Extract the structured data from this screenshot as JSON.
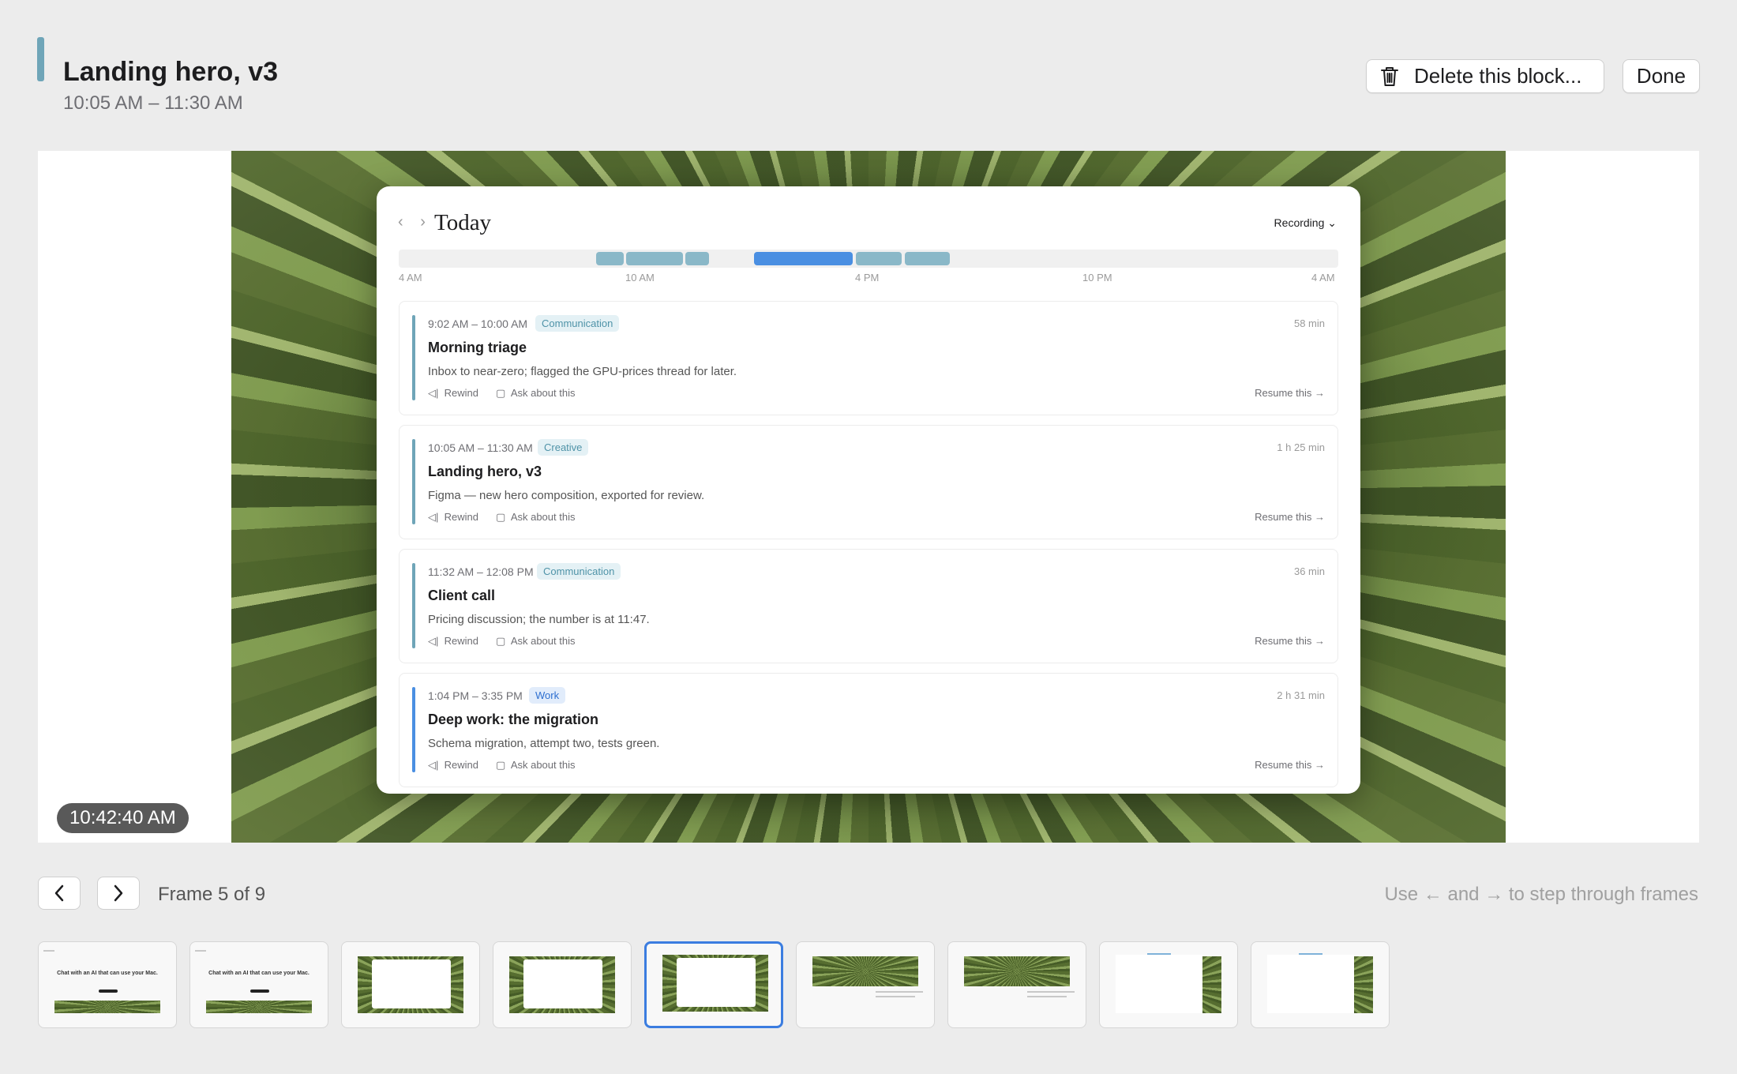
{
  "header": {
    "title": "Landing hero, v3",
    "time_range": "10:05 AM – 11:30 AM",
    "delete_label": "Delete this block...",
    "done_label": "Done"
  },
  "preview": {
    "timestamp": "10:42:40 AM",
    "app": {
      "title": "Today",
      "recording_label": "Recording",
      "timeline_ticks": [
        "4 AM",
        "10 AM",
        "4 PM",
        "10 PM",
        "4 AM"
      ],
      "cards": [
        {
          "time": "9:02 AM – 10:00 AM",
          "tag": "Communication",
          "title": "Morning triage",
          "description": "Inbox to near-zero; flagged the GPU-prices thread for later.",
          "duration": "58 min",
          "rewind": "Rewind",
          "ask": "Ask about this",
          "resume": "Resume this →"
        },
        {
          "time": "10:05 AM – 11:30 AM",
          "tag": "Creative",
          "title": "Landing hero, v3",
          "description": "Figma — new hero composition, exported for review.",
          "duration": "1 h 25 min",
          "rewind": "Rewind",
          "ask": "Ask about this",
          "resume": "Resume this →"
        },
        {
          "time": "11:32 AM – 12:08 PM",
          "tag": "Communication",
          "title": "Client call",
          "description": "Pricing discussion; the number is at 11:47.",
          "duration": "36 min",
          "rewind": "Rewind",
          "ask": "Ask about this",
          "resume": "Resume this →"
        },
        {
          "time": "1:04 PM – 3:35 PM",
          "tag": "Work",
          "title": "Deep work: the migration",
          "description": "Schema migration, attempt two, tests green.",
          "duration": "2 h 31 min",
          "rewind": "Rewind",
          "ask": "Ask about this",
          "resume": "Resume this →"
        }
      ]
    }
  },
  "frame_nav": {
    "label": "Frame 5 of 9",
    "hint": "Use ← and → to step through frames",
    "current": 5,
    "total": 9
  },
  "thumbnails": {
    "hero_text": "Chat with an AI that can use your Mac."
  },
  "colors": {
    "accent_creative": "#6fa5b8",
    "accent_work": "#4a8fe2",
    "selected_border": "#3b7de0"
  },
  "icons": {
    "delete": "trash-icon",
    "prev": "chevron-left-icon",
    "next": "chevron-right-icon",
    "rewind": "rewind-icon",
    "ask": "speech-bubble-icon"
  }
}
